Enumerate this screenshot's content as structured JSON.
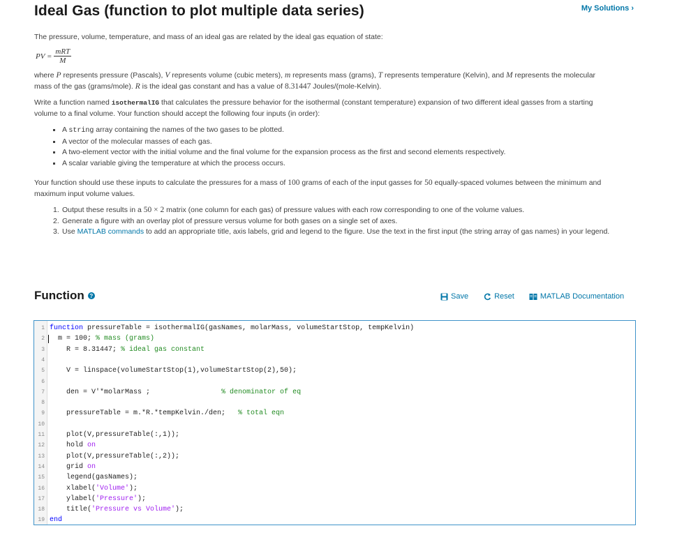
{
  "header": {
    "title": "Ideal Gas (function to plot multiple data series)",
    "my_solutions": "My Solutions ›"
  },
  "intro": "The pressure, volume, temperature, and mass of an ideal gas are related by the ideal gas equation of state:",
  "equation": {
    "lhs": "PV =",
    "numerator": "mRT",
    "denominator": "M"
  },
  "where_paragraph": {
    "t1": "where ",
    "P": "P",
    "t2": " represents pressure (Pascals), ",
    "V": "V",
    "t3": " represents volume (cubic meters), ",
    "m": "m",
    "t4": " represents mass (grams), ",
    "T": "T",
    "t5": " represents temperature (Kelvin), and ",
    "M": "M",
    "t6": " represents the molecular mass of the gas (grams/mole).  ",
    "R": "R",
    "t7": " is the ideal gas constant and has a value of ",
    "R_value": "8.31447",
    "t8": " Joules/(mole-Kelvin)."
  },
  "write_paragraph": {
    "t1": "Write a function named ",
    "fname": "isothermalIG",
    "t2": " that calculates the pressure behavior for the isothermal (constant temperature) expansion of two different ideal gasses from a starting volume to a final volume.  Your function should accept the following four inputs (in order):"
  },
  "inputs": {
    "b1_pre": "A ",
    "b1_code": "string",
    "b1_post": " array containing the names of the two gases to be plotted.",
    "b2": "A vector of the molecular masses of each gas.",
    "b3": "A two-element vector with the initial volume and the final volume for the expansion process as the first and second elements respectively.",
    "b4": "A scalar variable giving the temperature at which the process occurs."
  },
  "usage_paragraph": {
    "t1": "Your function should use these inputs to calculate the pressures for a mass of ",
    "mass": "100",
    "t2": " grams of each of the input gasses for ",
    "count": "50",
    "t3": " equally-spaced volumes between the minimum and maximum input volume values."
  },
  "steps": {
    "s1_num": "1.",
    "s1_pre": "Output these results in a ",
    "s1_dim": "50 × 2",
    "s1_post": " matrix (one column for each gas) of pressure values with each row corresponding to one of the volume values.",
    "s2_num": "2.",
    "s2": "Generate a figure with an overlay plot of pressure versus volume for both gases on a single set of axes.",
    "s3_num": "3.",
    "s3_pre": "Use ",
    "s3_link": "MATLAB commands",
    "s3_post": " to add an appropriate title, axis labels, grid and legend to the figure.  Use the text in the first input (the string array of gas names) in your legend."
  },
  "function_section": {
    "title": "Function",
    "help_glyph": "?",
    "save": "Save",
    "reset": "Reset",
    "docs": "MATLAB Documentation"
  },
  "editor": {
    "lines": [
      {
        "n": "1",
        "parts": [
          {
            "c": "kw",
            "t": "function"
          },
          {
            "c": "",
            "t": " pressureTable = isothermalIG(gasNames, molarMass, volumeStartStop, tempKelvin)"
          }
        ]
      },
      {
        "n": "2",
        "parts": [
          {
            "c": "",
            "t": "  m = 100; "
          },
          {
            "c": "cm",
            "t": "% mass (grams)"
          }
        ]
      },
      {
        "n": "3",
        "parts": [
          {
            "c": "",
            "t": "    R = 8.31447; "
          },
          {
            "c": "cm",
            "t": "% ideal gas constant"
          }
        ]
      },
      {
        "n": "4",
        "parts": []
      },
      {
        "n": "5",
        "parts": [
          {
            "c": "",
            "t": "    V = linspace(volumeStartStop(1),volumeStartStop(2),50);"
          }
        ]
      },
      {
        "n": "6",
        "parts": []
      },
      {
        "n": "7",
        "parts": [
          {
            "c": "",
            "t": "    den = V'*molarMass ;                 "
          },
          {
            "c": "cm",
            "t": "% denominator of eq"
          }
        ]
      },
      {
        "n": "8",
        "parts": []
      },
      {
        "n": "9",
        "parts": [
          {
            "c": "",
            "t": "    pressureTable = m.*R.*tempKelvin./den;   "
          },
          {
            "c": "cm",
            "t": "% total eqn"
          }
        ]
      },
      {
        "n": "10",
        "parts": []
      },
      {
        "n": "11",
        "parts": [
          {
            "c": "",
            "t": "    plot(V,pressureTable(:,1));"
          }
        ]
      },
      {
        "n": "12",
        "parts": [
          {
            "c": "",
            "t": "    hold "
          },
          {
            "c": "st",
            "t": "on"
          }
        ]
      },
      {
        "n": "13",
        "parts": [
          {
            "c": "",
            "t": "    plot(V,pressureTable(:,2));"
          }
        ]
      },
      {
        "n": "14",
        "parts": [
          {
            "c": "",
            "t": "    grid "
          },
          {
            "c": "st",
            "t": "on"
          }
        ]
      },
      {
        "n": "15",
        "parts": [
          {
            "c": "",
            "t": "    legend(gasNames);"
          }
        ]
      },
      {
        "n": "16",
        "parts": [
          {
            "c": "",
            "t": "    xlabel("
          },
          {
            "c": "st",
            "t": "'Volume'"
          },
          {
            "c": "",
            "t": ");"
          }
        ]
      },
      {
        "n": "17",
        "parts": [
          {
            "c": "",
            "t": "    ylabel("
          },
          {
            "c": "st",
            "t": "'Pressure'"
          },
          {
            "c": "",
            "t": ");"
          }
        ]
      },
      {
        "n": "18",
        "parts": [
          {
            "c": "",
            "t": "    title("
          },
          {
            "c": "st",
            "t": "'Pressure vs Volume'"
          },
          {
            "c": "",
            "t": ");"
          }
        ]
      },
      {
        "n": "19",
        "parts": [
          {
            "c": "kw",
            "t": "end"
          }
        ]
      }
    ]
  },
  "colors": {
    "accent": "#0076a8",
    "editor_border": "#3f93c9",
    "keyword": "#0000ff",
    "comment": "#228b22",
    "string": "#a020f0"
  }
}
